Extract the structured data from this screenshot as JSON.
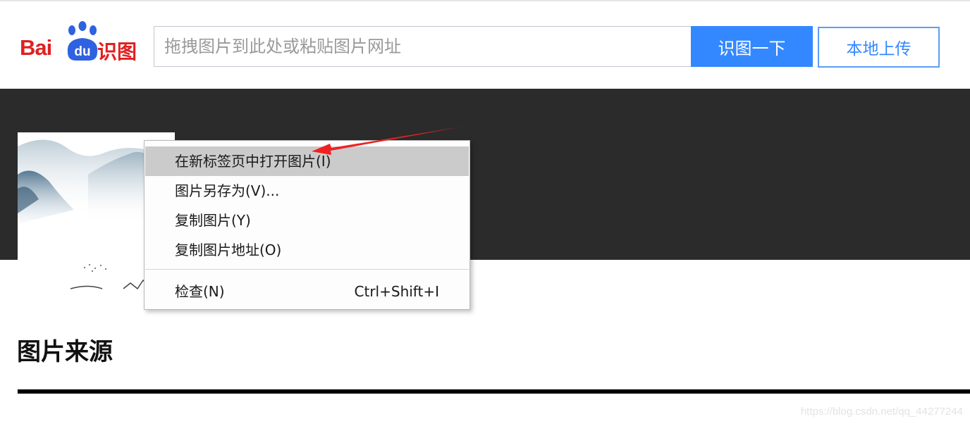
{
  "header": {
    "logo": {
      "bai": "Bai",
      "du": "du",
      "shitu": "识图"
    },
    "search": {
      "placeholder": "拖拽图片到此处或粘贴图片网址",
      "value": ""
    },
    "search_button_label": "识图一下",
    "upload_button_label": "本地上传"
  },
  "context_menu": {
    "items": [
      {
        "label": "在新标签页中打开图片(I)",
        "highlighted": true
      },
      {
        "label": "图片另存为(V)..."
      },
      {
        "label": "复制图片(Y)"
      },
      {
        "label": "复制图片地址(O)"
      },
      {
        "label": "检查(N)",
        "shortcut": "Ctrl+Shift+I"
      }
    ]
  },
  "section": {
    "title": "图片来源"
  },
  "watermark": "https://blog.csdn.net/qq_44277244",
  "colors": {
    "brand_red": "#e02020",
    "brand_blue": "#3388ff",
    "dark_band": "#2b2b2b",
    "menu_highlight": "#cbcbcb",
    "annotation_arrow": "#ee2222"
  }
}
